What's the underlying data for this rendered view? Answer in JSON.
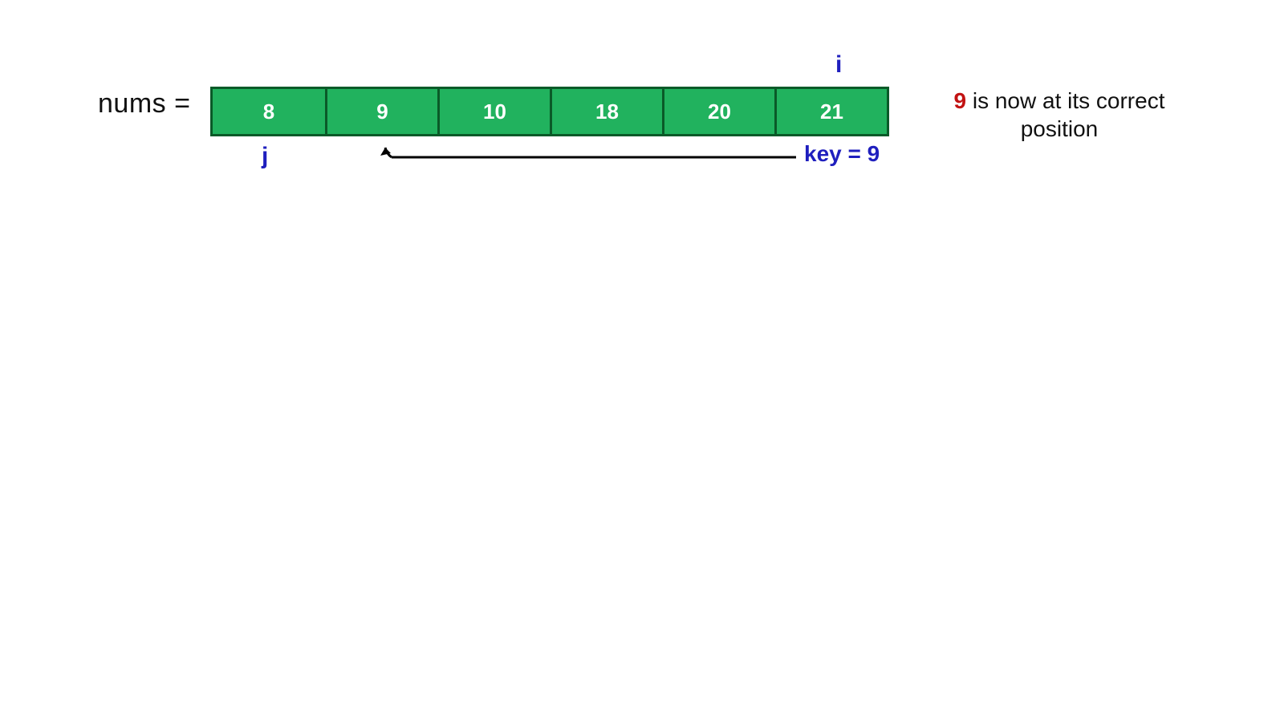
{
  "label": "nums =",
  "cells": [
    "8",
    "9",
    "10",
    "18",
    "20",
    "21"
  ],
  "pointers": {
    "i": "i",
    "j": "j"
  },
  "key_text": "key = 9",
  "caption": {
    "highlight": "9",
    "rest": " is now at its correct position"
  },
  "colors": {
    "cell_fill": "#21b25e",
    "cell_border": "#0a5a28",
    "pointer": "#1f1fbe",
    "highlight": "#c21313"
  }
}
